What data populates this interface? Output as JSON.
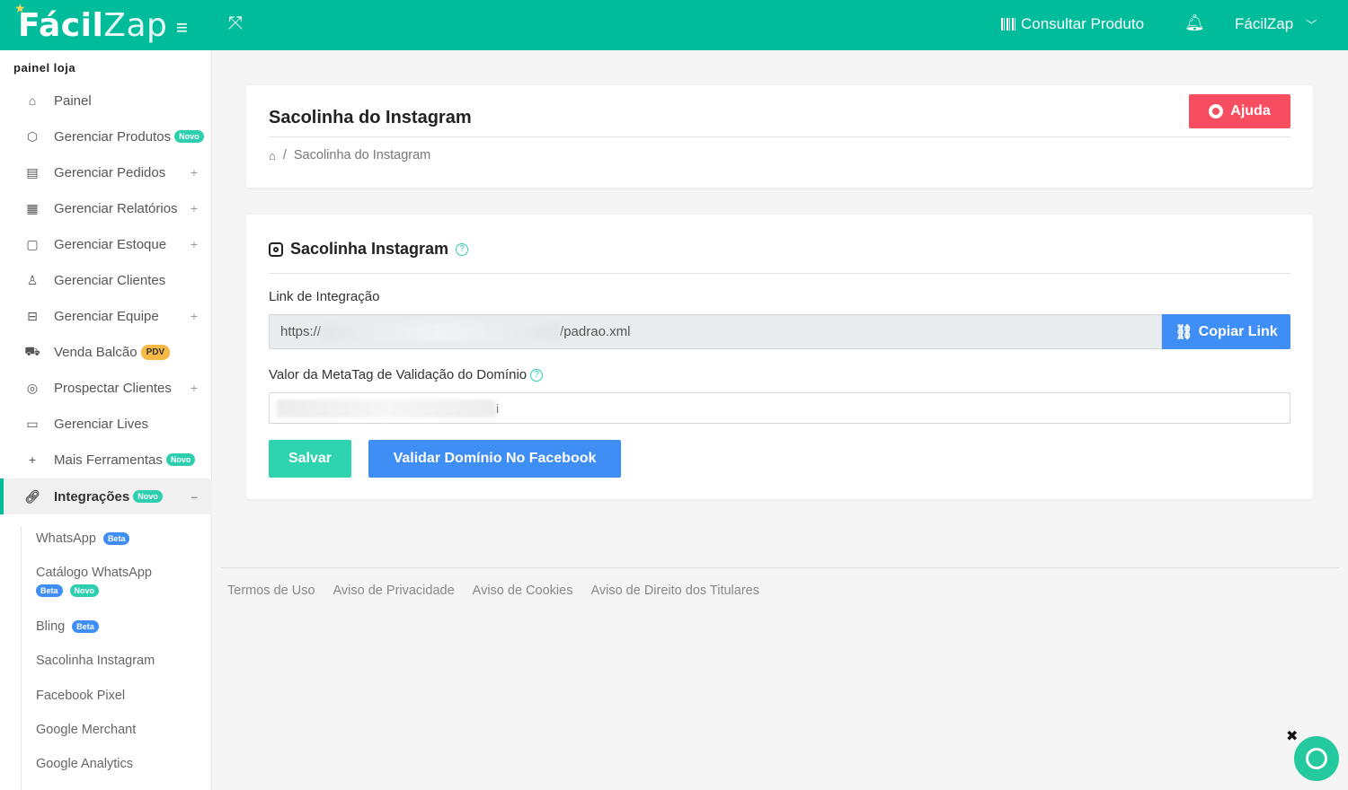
{
  "header": {
    "logo_part1": "Fácil",
    "logo_part2": "Zap",
    "consultar": "Consultar Produto",
    "user": "FácilZap"
  },
  "sidebar": {
    "title": "painel loja",
    "items": [
      {
        "label": "Painel",
        "icon": "home-icon"
      },
      {
        "label": "Gerenciar Produtos",
        "icon": "box-icon",
        "badge": "Novo"
      },
      {
        "label": "Gerenciar Pedidos",
        "icon": "receipt-icon",
        "expand": "+"
      },
      {
        "label": "Gerenciar Relatórios",
        "icon": "calendar-icon",
        "expand": "+"
      },
      {
        "label": "Gerenciar Estoque",
        "icon": "clipboard-icon",
        "expand": "+"
      },
      {
        "label": "Gerenciar Clientes",
        "icon": "user-icon"
      },
      {
        "label": "Gerenciar Equipe",
        "icon": "briefcase-icon",
        "expand": "+"
      },
      {
        "label": "Venda Balcão",
        "icon": "cart-icon",
        "badge": "PDV"
      },
      {
        "label": "Prospectar Clientes",
        "icon": "whatsapp-icon",
        "expand": "+"
      },
      {
        "label": "Gerenciar Lives",
        "icon": "video-icon"
      },
      {
        "label": "Mais Ferramentas",
        "icon": "plus-icon",
        "badge": "Novo"
      },
      {
        "label": "Integrações",
        "icon": "link-icon",
        "badge": "Novo",
        "expand": "–"
      }
    ],
    "submenu": [
      {
        "label": "WhatsApp",
        "badge": "Beta"
      },
      {
        "label": "Catálogo WhatsApp",
        "badge1": "Beta",
        "badge2": "Novo"
      },
      {
        "label": "Bling",
        "badge": "Beta"
      },
      {
        "label": "Sacolinha Instagram"
      },
      {
        "label": "Facebook Pixel"
      },
      {
        "label": "Google Merchant"
      },
      {
        "label": "Google Analytics"
      }
    ]
  },
  "page": {
    "title": "Sacolinha do Instagram",
    "help_button": "Ajuda",
    "breadcrumb_sep": "/",
    "breadcrumb_current": "Sacolinha do Instagram"
  },
  "form": {
    "section_title": "Sacolinha Instagram",
    "link_label": "Link de Integração",
    "link_prefix": "https://",
    "link_suffix": "/padrao.xml",
    "copy_button": "Copiar Link",
    "meta_label": "Valor da MetaTag de Validação do Domínio",
    "meta_value_end": "i",
    "save_button": "Salvar",
    "validate_button": "Validar Domínio No Facebook"
  },
  "footer": {
    "links": [
      "Termos de Uso",
      "Aviso de Privacidade",
      "Aviso de Cookies",
      "Aviso de Direito dos Titulares"
    ]
  },
  "colors": {
    "brand": "#00bc9b",
    "danger": "#f64e60",
    "primary": "#3f8ef6",
    "success": "#2ed3b0"
  }
}
